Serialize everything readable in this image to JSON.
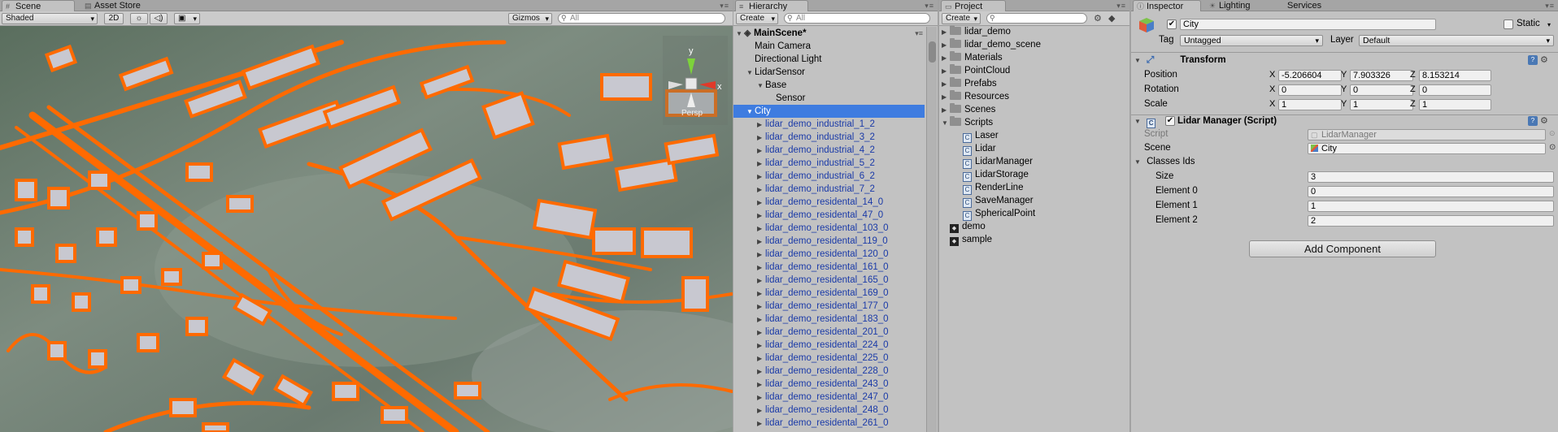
{
  "scene_panel": {
    "tabs": [
      {
        "label": "Scene",
        "icon": "scene-tab-icon"
      },
      {
        "label": "Asset Store",
        "icon": "store-tab-icon"
      }
    ],
    "toolbar": {
      "shading_mode": "Shaded",
      "mode_2d": "2D",
      "gizmos_label": "Gizmos",
      "search_placeholder": "All"
    },
    "gizmo": {
      "y_label": "y",
      "x_label": "x",
      "persp_label": "Persp"
    },
    "accent_color": "#ff6a00"
  },
  "hierarchy": {
    "tab_label": "Hierarchy",
    "create_label": "Create",
    "search_placeholder": "All",
    "scene_name": "MainScene*",
    "items": [
      {
        "label": "Main Camera",
        "indent": 1,
        "arrow": ""
      },
      {
        "label": "Directional Light",
        "indent": 1,
        "arrow": ""
      },
      {
        "label": "LidarSensor",
        "indent": 1,
        "arrow": "▼"
      },
      {
        "label": "Base",
        "indent": 2,
        "arrow": "▼"
      },
      {
        "label": "Sensor",
        "indent": 3,
        "arrow": ""
      },
      {
        "label": "City",
        "indent": 1,
        "arrow": "▼",
        "selected": true
      },
      {
        "label": "lidar_demo_industrial_1_2",
        "indent": 2,
        "arrow": "▶",
        "prefab": true
      },
      {
        "label": "lidar_demo_industrial_3_2",
        "indent": 2,
        "arrow": "▶",
        "prefab": true
      },
      {
        "label": "lidar_demo_industrial_4_2",
        "indent": 2,
        "arrow": "▶",
        "prefab": true
      },
      {
        "label": "lidar_demo_industrial_5_2",
        "indent": 2,
        "arrow": "▶",
        "prefab": true
      },
      {
        "label": "lidar_demo_industrial_6_2",
        "indent": 2,
        "arrow": "▶",
        "prefab": true
      },
      {
        "label": "lidar_demo_industrial_7_2",
        "indent": 2,
        "arrow": "▶",
        "prefab": true
      },
      {
        "label": "lidar_demo_residental_14_0",
        "indent": 2,
        "arrow": "▶",
        "prefab": true
      },
      {
        "label": "lidar_demo_residental_47_0",
        "indent": 2,
        "arrow": "▶",
        "prefab": true
      },
      {
        "label": "lidar_demo_residental_103_0",
        "indent": 2,
        "arrow": "▶",
        "prefab": true
      },
      {
        "label": "lidar_demo_residental_119_0",
        "indent": 2,
        "arrow": "▶",
        "prefab": true
      },
      {
        "label": "lidar_demo_residental_120_0",
        "indent": 2,
        "arrow": "▶",
        "prefab": true
      },
      {
        "label": "lidar_demo_residental_161_0",
        "indent": 2,
        "arrow": "▶",
        "prefab": true
      },
      {
        "label": "lidar_demo_residental_165_0",
        "indent": 2,
        "arrow": "▶",
        "prefab": true
      },
      {
        "label": "lidar_demo_residental_169_0",
        "indent": 2,
        "arrow": "▶",
        "prefab": true
      },
      {
        "label": "lidar_demo_residental_177_0",
        "indent": 2,
        "arrow": "▶",
        "prefab": true
      },
      {
        "label": "lidar_demo_residental_183_0",
        "indent": 2,
        "arrow": "▶",
        "prefab": true
      },
      {
        "label": "lidar_demo_residental_201_0",
        "indent": 2,
        "arrow": "▶",
        "prefab": true
      },
      {
        "label": "lidar_demo_residental_224_0",
        "indent": 2,
        "arrow": "▶",
        "prefab": true
      },
      {
        "label": "lidar_demo_residental_225_0",
        "indent": 2,
        "arrow": "▶",
        "prefab": true
      },
      {
        "label": "lidar_demo_residental_228_0",
        "indent": 2,
        "arrow": "▶",
        "prefab": true
      },
      {
        "label": "lidar_demo_residental_243_0",
        "indent": 2,
        "arrow": "▶",
        "prefab": true
      },
      {
        "label": "lidar_demo_residental_247_0",
        "indent": 2,
        "arrow": "▶",
        "prefab": true
      },
      {
        "label": "lidar_demo_residental_248_0",
        "indent": 2,
        "arrow": "▶",
        "prefab": true
      },
      {
        "label": "lidar_demo_residental_261_0",
        "indent": 2,
        "arrow": "▶",
        "prefab": true
      }
    ]
  },
  "project": {
    "tab_label": "Project",
    "create_label": "Create",
    "items": [
      {
        "label": "lidar_demo",
        "type": "folder",
        "arrow": "▶",
        "indent": 0
      },
      {
        "label": "lidar_demo_scene",
        "type": "folder",
        "arrow": "▶",
        "indent": 0
      },
      {
        "label": "Materials",
        "type": "folder",
        "arrow": "▶",
        "indent": 0
      },
      {
        "label": "PointCloud",
        "type": "folder",
        "arrow": "▶",
        "indent": 0
      },
      {
        "label": "Prefabs",
        "type": "folder",
        "arrow": "▶",
        "indent": 0
      },
      {
        "label": "Resources",
        "type": "folder",
        "arrow": "▶",
        "indent": 0
      },
      {
        "label": "Scenes",
        "type": "folder",
        "arrow": "▶",
        "indent": 0
      },
      {
        "label": "Scripts",
        "type": "folder",
        "arrow": "▼",
        "indent": 0
      },
      {
        "label": "Laser",
        "type": "script",
        "arrow": "",
        "indent": 1
      },
      {
        "label": "Lidar",
        "type": "script",
        "arrow": "",
        "indent": 1
      },
      {
        "label": "LidarManager",
        "type": "script",
        "arrow": "",
        "indent": 1
      },
      {
        "label": "LidarStorage",
        "type": "script",
        "arrow": "",
        "indent": 1
      },
      {
        "label": "RenderLine",
        "type": "script",
        "arrow": "",
        "indent": 1
      },
      {
        "label": "SaveManager",
        "type": "script",
        "arrow": "",
        "indent": 1
      },
      {
        "label": "SphericalPoint",
        "type": "script",
        "arrow": "",
        "indent": 1
      },
      {
        "label": "demo",
        "type": "scene",
        "arrow": "",
        "indent": 0
      },
      {
        "label": "sample",
        "type": "scene",
        "arrow": "",
        "indent": 0
      }
    ]
  },
  "inspector": {
    "tabs": [
      "Inspector",
      "Lighting",
      "Services"
    ],
    "object_name": "City",
    "static_label": "Static",
    "tag_label": "Tag",
    "tag_value": "Untagged",
    "layer_label": "Layer",
    "layer_value": "Default",
    "transform": {
      "title": "Transform",
      "rows": [
        {
          "label": "Position",
          "x": "-5.206604",
          "y": "7.903326",
          "z": "8.153214"
        },
        {
          "label": "Rotation",
          "x": "0",
          "y": "0",
          "z": "0"
        },
        {
          "label": "Scale",
          "x": "1",
          "y": "1",
          "z": "1"
        }
      ],
      "axis_x": "X",
      "axis_y": "Y",
      "axis_z": "Z"
    },
    "lidar_manager": {
      "title": "Lidar Manager (Script)",
      "script_label": "Script",
      "script_value": "LidarManager",
      "scene_label": "Scene",
      "scene_value": "City",
      "classes_label": "Classes Ids",
      "size_label": "Size",
      "size_value": "3",
      "elements": [
        {
          "label": "Element 0",
          "value": "0"
        },
        {
          "label": "Element 1",
          "value": "1"
        },
        {
          "label": "Element 2",
          "value": "2"
        }
      ]
    },
    "add_component_label": "Add Component"
  }
}
